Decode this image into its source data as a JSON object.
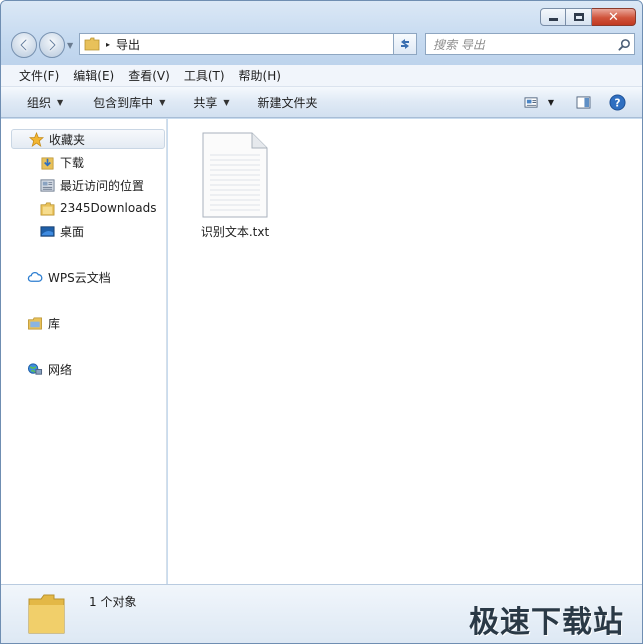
{
  "window": {
    "controls": {
      "minimize": "—",
      "maximize": "□",
      "close": "✕"
    }
  },
  "nav": {
    "address": {
      "path": "导出",
      "separator": "▸"
    },
    "search": {
      "placeholder": "搜索 导出"
    }
  },
  "menu": [
    {
      "label": "文件(F)"
    },
    {
      "label": "编辑(E)"
    },
    {
      "label": "查看(V)"
    },
    {
      "label": "工具(T)"
    },
    {
      "label": "帮助(H)"
    }
  ],
  "toolbar": {
    "organize": "组织",
    "include_in_library": "包含到库中",
    "share": "共享",
    "new_folder": "新建文件夹",
    "dropdown_arrow": "▼"
  },
  "sidebar": {
    "favorites": {
      "label": "收藏夹",
      "items": [
        {
          "label": "下载",
          "icon": "download-folder-icon"
        },
        {
          "label": "最近访问的位置",
          "icon": "recent-places-icon"
        },
        {
          "label": "2345Downloads",
          "icon": "folder-icon"
        },
        {
          "label": "桌面",
          "icon": "desktop-icon"
        }
      ]
    },
    "wps": {
      "label": "WPS云文档",
      "icon": "cloud-icon"
    },
    "libraries": {
      "label": "库",
      "icon": "library-icon"
    },
    "network": {
      "label": "网络",
      "icon": "network-icon"
    }
  },
  "files": [
    {
      "name": "识别文本.txt",
      "icon": "text-file-icon"
    }
  ],
  "details": {
    "count_text": "1 个对象"
  },
  "watermark": {
    "text": "极速下载站"
  },
  "colors": {
    "accent": "#3b6fb0",
    "folder": "#e8c15a",
    "star": "#f2b632"
  }
}
